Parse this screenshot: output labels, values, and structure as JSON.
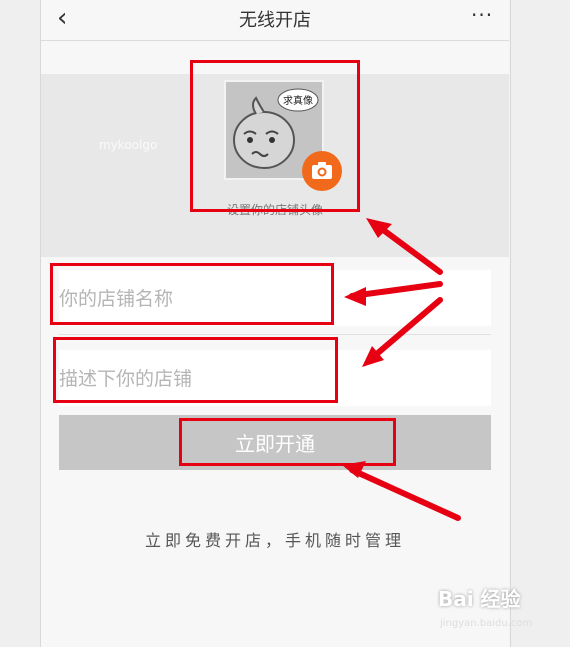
{
  "header": {
    "back_icon": "chevron-left-icon",
    "title": "无线开店",
    "more_label": "···"
  },
  "banner": {
    "watermark": "mykoolgo",
    "avatar_bubble_text": "求真像",
    "camera_icon": "camera-icon",
    "caption": "设置你的店铺头像"
  },
  "form": {
    "shop_name_placeholder": "你的店铺名称",
    "shop_desc_placeholder": "描述下你的店铺",
    "open_button_label": "立即开通"
  },
  "slogan": "立即免费开店，手机随时管理",
  "logo": {
    "brand": "Bai 经验",
    "url": "jingyan.baidu.com"
  },
  "colors": {
    "annotation_red": "#e60012",
    "camera_orange": "#f16a1c",
    "button_gray": "#c6c6c6"
  }
}
